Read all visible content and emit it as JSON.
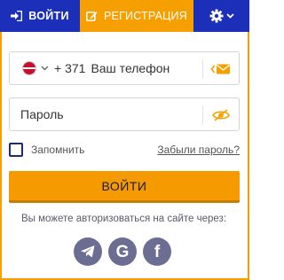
{
  "tabs": {
    "login_label": "ВОЙТИ",
    "register_label": "РЕГИСТРАЦИЯ",
    "login_icon": "sign-in-icon",
    "register_icon": "edit-icon",
    "settings_icon": "gear-icon"
  },
  "phone": {
    "country_flag": "latvia-flag",
    "country_code": "+ 371",
    "placeholder": "Ваш телефон",
    "switch_icon": "envelope-icon"
  },
  "password": {
    "placeholder": "Пароль",
    "toggle_icon": "eye-slash-icon"
  },
  "remember_label": "Запомнить",
  "forgot_label": "Забыли пароль?",
  "submit_label": "ВОЙТИ",
  "social_text": "Вы можете авторизоваться на сайте через:",
  "socials": [
    {
      "name": "telegram",
      "icon": "telegram-icon"
    },
    {
      "name": "google",
      "icon": "google-icon",
      "glyph": "G"
    },
    {
      "name": "facebook",
      "icon": "facebook-icon",
      "glyph": "f"
    }
  ],
  "colors": {
    "primary_blue": "#1b2fb8",
    "accent_orange": "#f5a000",
    "social_gray": "#6b6e92"
  }
}
